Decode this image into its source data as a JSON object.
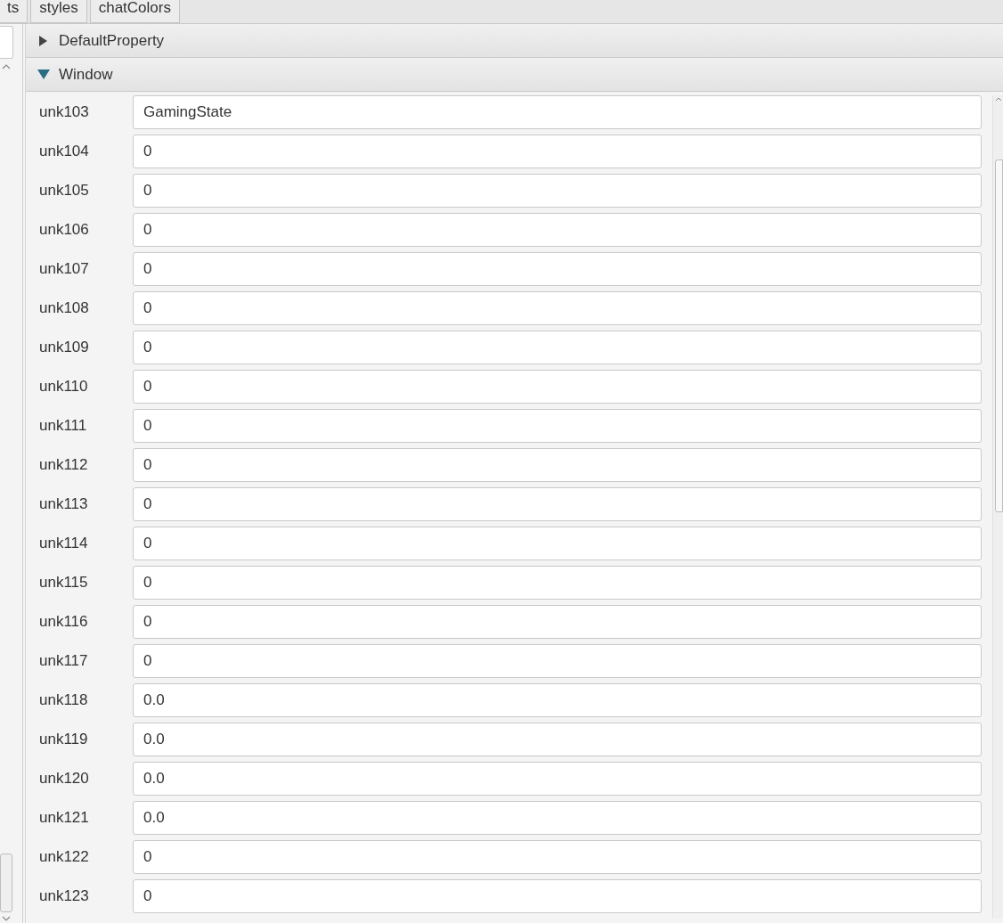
{
  "tabs": [
    {
      "label": "ts"
    },
    {
      "label": "styles"
    },
    {
      "label": "chatColors"
    }
  ],
  "sections": [
    {
      "title": "DefaultProperty",
      "expanded": false
    },
    {
      "title": "Window",
      "expanded": true,
      "fields": [
        {
          "label": "unk103",
          "value": "GamingState"
        },
        {
          "label": "unk104",
          "value": "0"
        },
        {
          "label": "unk105",
          "value": "0"
        },
        {
          "label": "unk106",
          "value": "0"
        },
        {
          "label": "unk107",
          "value": "0"
        },
        {
          "label": "unk108",
          "value": "0"
        },
        {
          "label": "unk109",
          "value": "0"
        },
        {
          "label": "unk110",
          "value": "0"
        },
        {
          "label": "unk111",
          "value": "0"
        },
        {
          "label": "unk112",
          "value": "0"
        },
        {
          "label": "unk113",
          "value": "0"
        },
        {
          "label": "unk114",
          "value": "0"
        },
        {
          "label": "unk115",
          "value": "0"
        },
        {
          "label": "unk116",
          "value": "0"
        },
        {
          "label": "unk117",
          "value": "0"
        },
        {
          "label": "unk118",
          "value": "0.0"
        },
        {
          "label": "unk119",
          "value": "0.0"
        },
        {
          "label": "unk120",
          "value": "0.0"
        },
        {
          "label": "unk121",
          "value": "0.0"
        },
        {
          "label": "unk122",
          "value": "0"
        },
        {
          "label": "unk123",
          "value": "0"
        }
      ]
    }
  ]
}
